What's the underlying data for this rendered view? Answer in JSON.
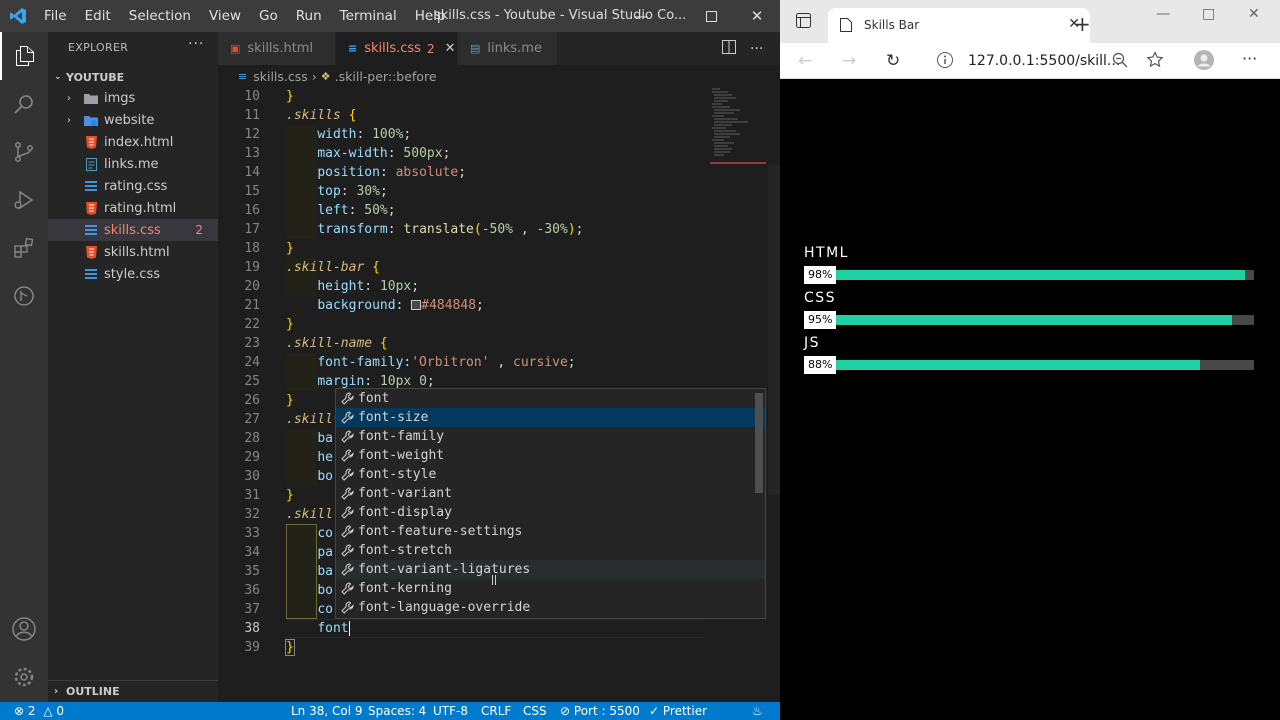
{
  "vscode": {
    "menu": [
      "File",
      "Edit",
      "Selection",
      "View",
      "Go",
      "Run",
      "Terminal",
      "Help"
    ],
    "window_title": "skills.css - Youtube - Visual Studio Co...",
    "explorer_title": "EXPLORER",
    "folder_name": "YOUTUBE",
    "tree": [
      {
        "name": "imgs",
        "kind": "folder"
      },
      {
        "name": "website",
        "kind": "folder"
      },
      {
        "name": "index.html",
        "kind": "html"
      },
      {
        "name": "links.me",
        "kind": "text"
      },
      {
        "name": "rating.css",
        "kind": "css"
      },
      {
        "name": "rating.html",
        "kind": "html"
      },
      {
        "name": "skills.css",
        "kind": "css",
        "badge": "2",
        "selected": true
      },
      {
        "name": "skills.html",
        "kind": "html"
      },
      {
        "name": "style.css",
        "kind": "css"
      }
    ],
    "outline_label": "OUTLINE",
    "tabs": [
      {
        "label": "skills.html",
        "kind": "html"
      },
      {
        "label": "skills.css",
        "kind": "css",
        "badge": "2",
        "active": true
      },
      {
        "label": "links.me",
        "kind": "text"
      }
    ],
    "breadcrumb": {
      "file": "skills.css",
      "symbol": ".skill-per::before"
    },
    "line_numbers": [
      "10",
      "11",
      "12",
      "13",
      "14",
      "15",
      "16",
      "17",
      "18",
      "19",
      "20",
      "21",
      "22",
      "23",
      "24",
      "25",
      "26",
      "27",
      "28",
      "29",
      "30",
      "31",
      "32",
      "33",
      "34",
      "35",
      "36",
      "37",
      "38",
      "39"
    ],
    "suggestions": [
      "font",
      "font-size",
      "font-family",
      "font-weight",
      "font-style",
      "font-variant",
      "font-display",
      "font-feature-settings",
      "font-stretch",
      "font-variant-ligatures",
      "font-kerning",
      "font-language-override"
    ],
    "typed_prefix": "font",
    "status": {
      "problems": "2",
      "warnings": "0",
      "position": "Ln 38, Col 9",
      "spaces": "Spaces: 4",
      "encoding": "UTF-8",
      "eol": "CRLF",
      "language": "CSS",
      "port": "Port : 5500",
      "formatter": "Prettier"
    },
    "accent_color": "#007acc"
  },
  "browser": {
    "tab_title": "Skills Bar",
    "url": "127.0.0.1:5500/skill...",
    "skills": [
      {
        "name": "HTML",
        "percent": 98,
        "label": "98%"
      },
      {
        "name": "CSS",
        "percent": 95,
        "label": "95%"
      },
      {
        "name": "JS",
        "percent": 88,
        "label": "88%"
      }
    ],
    "bar_color": "#1fd1a3"
  }
}
